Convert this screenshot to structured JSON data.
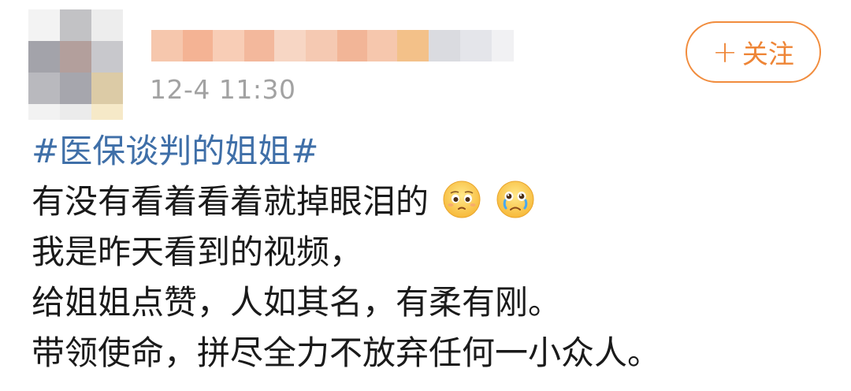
{
  "header": {
    "timestamp": "12-4 11:30",
    "follow_label": "关注",
    "follow_plus": "+"
  },
  "post": {
    "hashtag": "#医保谈判的姐姐#",
    "lines": [
      "有没有看着看着就掉眼泪的",
      "我是昨天看到的视频，",
      "给姐姐点赞，人如其名，有柔有刚。",
      "带领使命，拼尽全力不放弃任何一小众人。"
    ],
    "emojis": [
      "pleading-face-icon",
      "crying-face-icon"
    ]
  },
  "colors": {
    "hashtag": "#3f6fa8",
    "follow_accent": "#ee8536",
    "timestamp": "#a2a2a2",
    "text": "#1a1a1a"
  }
}
